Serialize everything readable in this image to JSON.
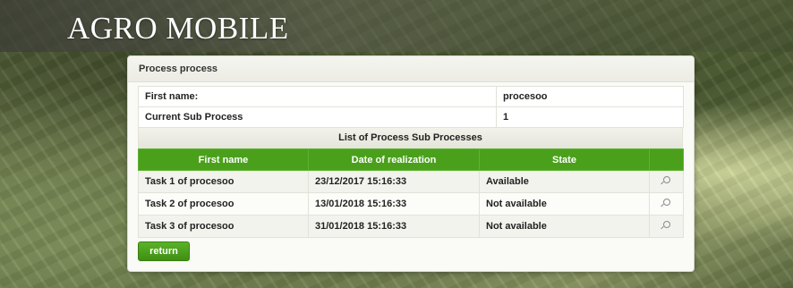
{
  "header": {
    "brand": "AGRO MOBILE"
  },
  "panel": {
    "title": "Process process",
    "info": [
      {
        "label": "First name:",
        "value": "procesoo"
      },
      {
        "label": "Current Sub Process",
        "value": "1"
      }
    ],
    "list_title": "List of Process Sub Processes",
    "columns": [
      "First name",
      "Date of realization",
      "State",
      ""
    ],
    "rows": [
      {
        "name": "Task 1 of procesoo",
        "date": "23/12/2017 15:16:33",
        "state": "Available",
        "icon": "magnifier-icon"
      },
      {
        "name": "Task 2 of procesoo",
        "date": "13/01/2018 15:16:33",
        "state": "Not available",
        "icon": "magnifier-icon"
      },
      {
        "name": "Task 3 of procesoo",
        "date": "31/01/2018 15:16:33",
        "state": "Not available",
        "icon": "magnifier-icon"
      }
    ],
    "return_label": "return"
  },
  "colors": {
    "accent_green": "#4aa01b",
    "panel_bg": "#fafaf6"
  }
}
